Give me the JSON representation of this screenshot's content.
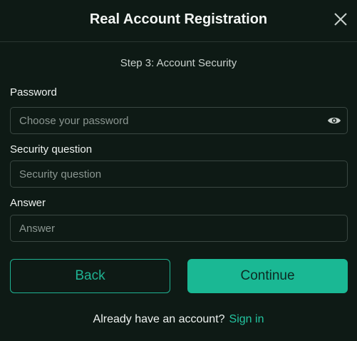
{
  "header": {
    "title": "Real Account Registration",
    "close_icon": "close-icon"
  },
  "step": "Step 3: Account Security",
  "password": {
    "label": "Password",
    "placeholder": "Choose your password",
    "value": "",
    "icon": "eye-icon"
  },
  "security_question": {
    "label": "Security question",
    "placeholder": "Security question",
    "value": ""
  },
  "answer": {
    "label": "Answer",
    "placeholder": "Answer",
    "value": ""
  },
  "buttons": {
    "back": "Back",
    "continue": "Continue"
  },
  "footer": {
    "text": "Already have an account?",
    "link": "Sign in"
  },
  "colors": {
    "background": "#0e1a15",
    "accent": "#1ab894",
    "link": "#23c4a0"
  }
}
